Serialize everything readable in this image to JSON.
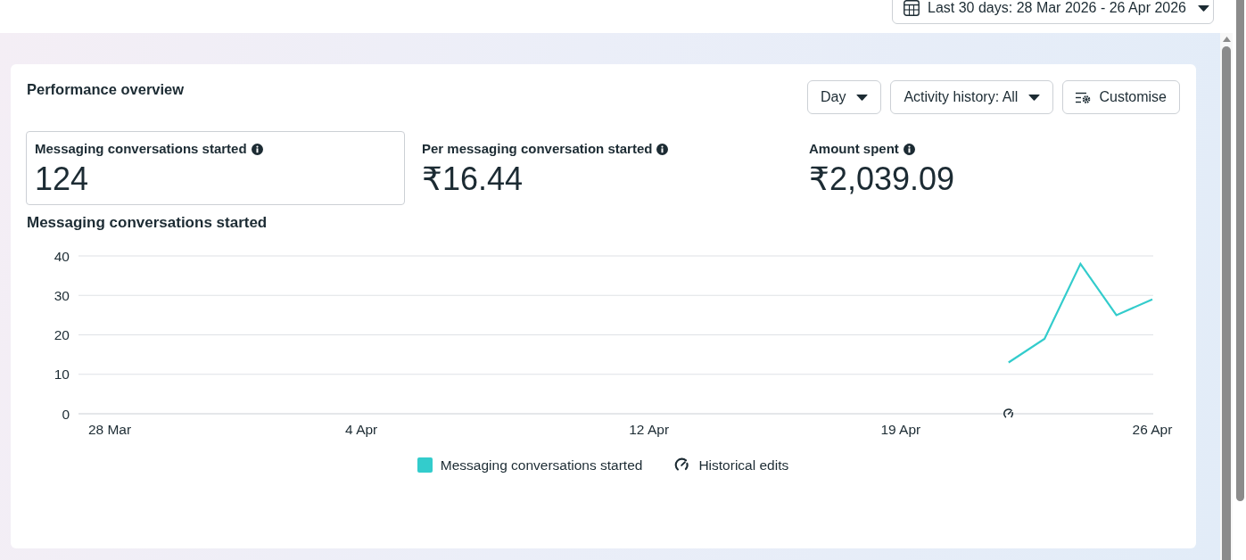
{
  "date_range": {
    "label": "Last 30 days: 28 Mar 2026 - 26 Apr 2026"
  },
  "performance": {
    "title": "Performance overview",
    "controls": [
      {
        "kind": "dropdown",
        "label": "Day"
      },
      {
        "kind": "dropdown",
        "label": "Activity history: All"
      },
      {
        "kind": "customise",
        "label": "Customise"
      }
    ],
    "metrics": [
      {
        "label": "Messaging conversations started",
        "value": "124",
        "selected": true
      },
      {
        "label": "Per messaging conversation started",
        "value": "₹16.44",
        "selected": false
      },
      {
        "label": "Amount spent",
        "value": "₹2,039.09",
        "selected": false
      }
    ],
    "chart_data": {
      "type": "line",
      "title": "Messaging conversations started",
      "categories": [
        "28 Mar",
        null,
        null,
        null,
        null,
        null,
        null,
        "4 Apr",
        null,
        null,
        null,
        null,
        null,
        null,
        null,
        "12 Apr",
        null,
        null,
        null,
        null,
        null,
        null,
        "19 Apr",
        null,
        null,
        null,
        null,
        null,
        null,
        "26 Apr"
      ],
      "series": [
        {
          "name": "Messaging conversations started",
          "color": "#33cccc",
          "values": [
            null,
            null,
            null,
            null,
            null,
            null,
            null,
            null,
            null,
            null,
            null,
            null,
            null,
            null,
            null,
            null,
            null,
            null,
            null,
            null,
            null,
            null,
            null,
            null,
            null,
            13,
            19,
            38,
            25,
            29
          ]
        },
        {
          "name": "Historical edits",
          "color": "#1c2b33",
          "marker": "cross",
          "values": [
            null,
            null,
            null,
            null,
            null,
            null,
            null,
            null,
            null,
            null,
            null,
            null,
            null,
            null,
            null,
            null,
            null,
            null,
            null,
            null,
            null,
            null,
            null,
            null,
            null,
            0,
            null,
            null,
            null,
            null
          ]
        }
      ],
      "ylim": [
        0,
        40
      ],
      "yticks": [
        0,
        10,
        20,
        30,
        40
      ],
      "grid": true
    }
  }
}
